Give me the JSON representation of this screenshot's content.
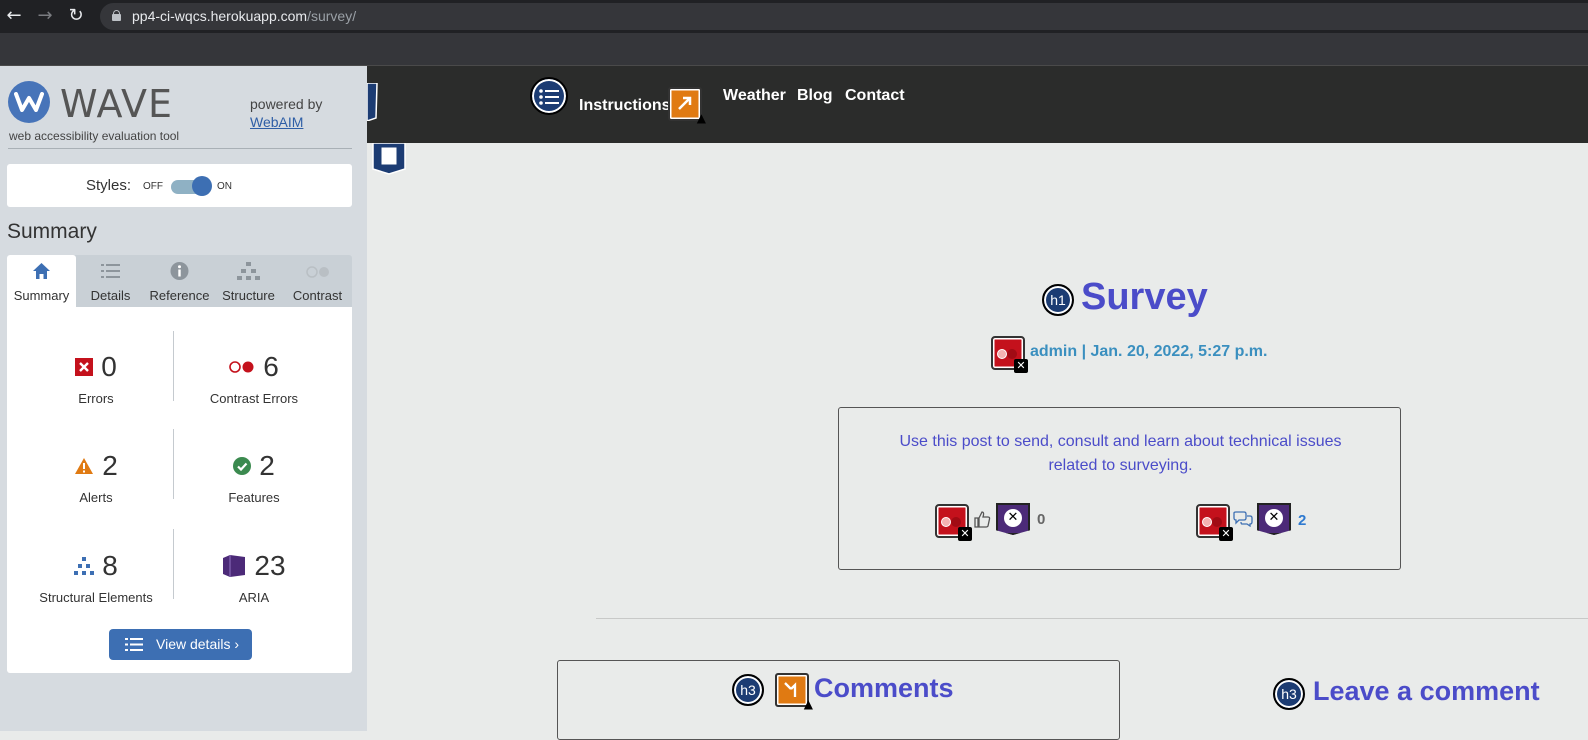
{
  "browser": {
    "back_icon": "back-arrow-icon",
    "forward_icon": "forward-arrow-icon",
    "reload_icon": "reload-icon",
    "url_host": "pp4-ci-wqcs.herokuapp.com",
    "url_path": "/survey/"
  },
  "wave": {
    "title": "WAVE",
    "subtitle": "web accessibility evaluation tool",
    "powered_by": "powered by",
    "webaim": "WebAIM",
    "styles_label": "Styles:",
    "off": "OFF",
    "on": "ON",
    "summary_heading": "Summary",
    "tabs": [
      {
        "label": "Summary",
        "icon": "home-icon",
        "active": true
      },
      {
        "label": "Details",
        "icon": "list-icon",
        "active": false
      },
      {
        "label": "Reference",
        "icon": "info-icon",
        "active": false
      },
      {
        "label": "Structure",
        "icon": "structure-icon",
        "active": false
      },
      {
        "label": "Contrast",
        "icon": "contrast-icon",
        "active": false
      }
    ],
    "stats": {
      "errors": {
        "value": "0",
        "label": "Errors",
        "color": "#c4111c"
      },
      "contrast": {
        "value": "6",
        "label": "Contrast Errors",
        "color": "#c4111c"
      },
      "alerts": {
        "value": "2",
        "label": "Alerts",
        "color": "#e07a12"
      },
      "features": {
        "value": "2",
        "label": "Features",
        "color": "#3b8a4f"
      },
      "structural": {
        "value": "8",
        "label": "Structural Elements",
        "color": "#3d6fb3"
      },
      "aria": {
        "value": "23",
        "label": "ARIA",
        "color": "#4c2a78"
      }
    },
    "view_details": "View details ›"
  },
  "site": {
    "nav": {
      "instructions": "Instructions",
      "weather": "Weather",
      "blog": "Blog",
      "contact": "Contact"
    },
    "post": {
      "h1_badge": "h1",
      "title": "Survey",
      "meta": "admin | Jan. 20, 2022, 5:27 p.m.",
      "body": "Use this post to send, consult and learn about technical issues related to surveying.",
      "likes": "0",
      "comments_count": "2"
    },
    "comments": {
      "h3_badge": "h3",
      "title": "Comments"
    },
    "leave": {
      "h3_badge": "h3",
      "title": "Leave a comment"
    }
  },
  "colors": {
    "accent_blue": "#3d6fb3",
    "title_purple": "#4b4cc9",
    "header_dark": "#2b2c2b"
  }
}
